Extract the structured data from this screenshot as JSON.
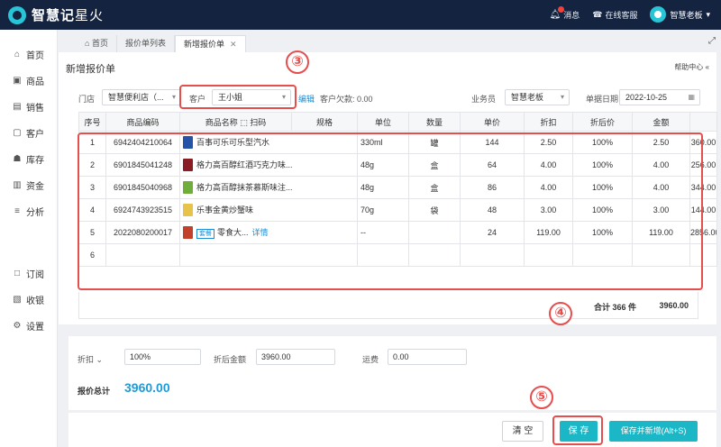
{
  "header": {
    "logo_main": "智慧记",
    "logo_sub": "星火",
    "messages_label": "消息",
    "support_label": "在线客服",
    "user_name": "智慧老板"
  },
  "sidebar": {
    "items": [
      {
        "label": "首页",
        "icon": "home-icon"
      },
      {
        "label": "商品",
        "icon": "box-icon"
      },
      {
        "label": "销售",
        "icon": "clipboard-icon"
      },
      {
        "label": "客户",
        "icon": "contact-icon"
      },
      {
        "label": "库存",
        "icon": "warehouse-icon"
      },
      {
        "label": "资金",
        "icon": "wallet-icon"
      },
      {
        "label": "分析",
        "icon": "chart-icon"
      }
    ],
    "bottom_items": [
      {
        "label": "订阅",
        "icon": "book-icon"
      },
      {
        "label": "收银",
        "icon": "cashier-icon"
      },
      {
        "label": "设置",
        "icon": "gear-icon"
      }
    ]
  },
  "tabs": {
    "home": "首页",
    "quote_list": "报价单列表",
    "new_quote": "新增报价单"
  },
  "form": {
    "title": "新增报价单",
    "help": "帮助中心",
    "store_label": "门店",
    "store_value": "智慧便利店（...",
    "customer_label": "客户",
    "customer_value": "王小姐",
    "edit_link": "编辑",
    "customer_debt": "客户欠款: 0.00",
    "salesman_label": "业务员",
    "salesman_value": "智慧老板",
    "date_label": "单据日期",
    "date_value": "2022-10-25"
  },
  "table": {
    "headers": [
      "序号",
      "商品编码",
      "商品名称",
      "扫码",
      "规格",
      "单位",
      "数量",
      "单价",
      "折扣",
      "折后价",
      "金额"
    ],
    "rows": [
      {
        "no": "1",
        "code": "6942404210064",
        "name": "百事可乐可乐型汽水",
        "spec": "330ml",
        "unit": "罐",
        "qty": "144",
        "price": "2.50",
        "discount": "100%",
        "disc_price": "2.50",
        "amount": "360.00",
        "thumb": "#2553a8"
      },
      {
        "no": "2",
        "code": "6901845041248",
        "name": "格力高百醇红酒巧克力味...",
        "spec": "48g",
        "unit": "盒",
        "qty": "64",
        "price": "4.00",
        "discount": "100%",
        "disc_price": "4.00",
        "amount": "256.00",
        "thumb": "#8a1d24"
      },
      {
        "no": "3",
        "code": "6901845040968",
        "name": "格力高百醇抹茶慕斯味注...",
        "spec": "48g",
        "unit": "盒",
        "qty": "86",
        "price": "4.00",
        "discount": "100%",
        "disc_price": "4.00",
        "amount": "344.00",
        "thumb": "#6fae3a"
      },
      {
        "no": "4",
        "code": "6924743923515",
        "name": "乐事金黄炒蟹味",
        "spec": "70g",
        "unit": "袋",
        "qty": "48",
        "price": "3.00",
        "discount": "100%",
        "disc_price": "3.00",
        "amount": "144.00",
        "thumb": "#e8c34a"
      },
      {
        "no": "5",
        "code": "2022080200017",
        "name": "零食大...",
        "tag": "套餐",
        "detail": "详情",
        "spec": "--",
        "unit": "",
        "qty": "24",
        "price": "119.00",
        "discount": "100%",
        "disc_price": "119.00",
        "amount": "2856.00",
        "thumb": "#c2412b",
        "extra": "热"
      },
      {
        "no": "6",
        "code": "",
        "name": "",
        "spec": "",
        "unit": "",
        "qty": "",
        "price": "",
        "discount": "",
        "disc_price": "",
        "amount": "",
        "thumb": ""
      }
    ],
    "total_label": "合计 366 件",
    "total_amount": "3960.00"
  },
  "summary": {
    "discount_label": "折扣",
    "discount_value": "100%",
    "after_discount_label": "折后金额",
    "after_discount_value": "3960.00",
    "shipping_label": "运费",
    "shipping_value": "0.00",
    "grand_total_label": "报价总计",
    "grand_total_value": "3960.00"
  },
  "actions": {
    "clear": "清 空",
    "save": "保 存",
    "save_new": "保存并新增(Alt+S)"
  },
  "annotations": {
    "step3": "③",
    "step4": "④",
    "step5": "⑤"
  },
  "colors": {
    "topbar": "#14233f",
    "accent": "#1bb7c6",
    "link": "#1a8fd6",
    "annotation": "#e64d4d"
  }
}
